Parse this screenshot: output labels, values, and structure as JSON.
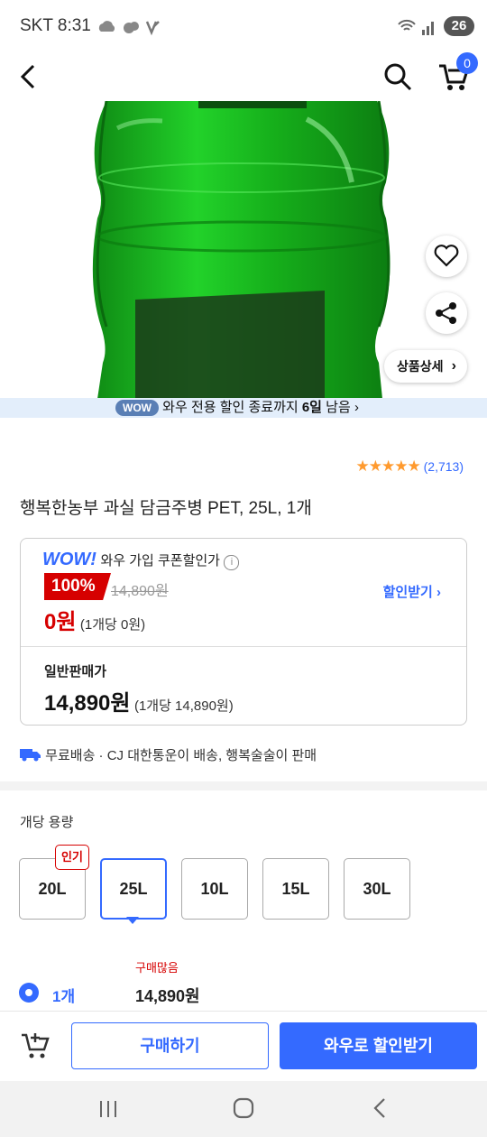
{
  "status": {
    "carrier": "SKT",
    "time": "8:31",
    "battery": "26"
  },
  "header": {
    "cart_count": "0"
  },
  "hero": {
    "detail_button": "상품상세"
  },
  "wow_banner": {
    "pill": "WOW",
    "text_prefix": "와우 전용 할인 종료까지 ",
    "days": "6일",
    "text_suffix": " 남음"
  },
  "rating": {
    "stars": 5,
    "count": "(2,713)"
  },
  "product": {
    "title": "행복한농부 과실 담금주병 PET, 25L, 1개"
  },
  "price_box": {
    "wow_logo": "WOW!",
    "wow_label": "와우 가입 쿠폰할인가",
    "discount": "100%",
    "original_price": "14,890원",
    "sale_price": "0원",
    "unit_sale": "(1개당 0원)",
    "discount_link": "할인받기",
    "normal_label": "일반판매가",
    "normal_price": "14,890원",
    "unit_normal": "(1개당 14,890원)"
  },
  "shipping": {
    "text": "무료배송 · CJ 대한통운이 배송, 행복술술이 판매"
  },
  "options": {
    "title": "개당 용량",
    "popular_badge": "인기",
    "items": [
      "20L",
      "25L",
      "10L",
      "15L",
      "30L"
    ],
    "selected": "25L"
  },
  "quantity": {
    "label": "1개",
    "note": "구매많음",
    "price": "14,890원"
  },
  "actions": {
    "buy": "구매하기",
    "wow_discount": "와우로 할인받기"
  },
  "colors": {
    "accent": "#346aff",
    "sale_red": "#d60000",
    "star": "#ff9a2e",
    "bottle_green": "#19c01e"
  }
}
